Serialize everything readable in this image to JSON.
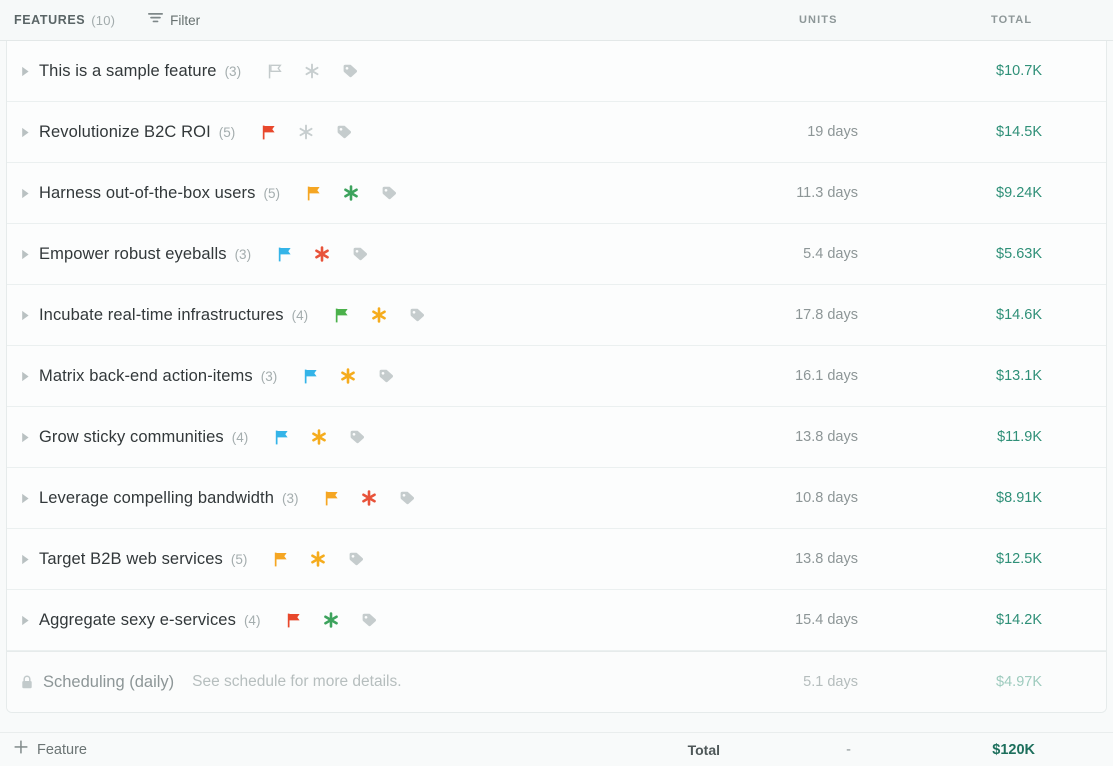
{
  "header": {
    "title": "FEATURES",
    "count": "(10)",
    "filter_label": "Filter",
    "filter_icon": "filter-icon",
    "units_label": "UNITS",
    "total_label": "TOTAL"
  },
  "colors": {
    "accent_total": "#2f9078",
    "footer_total": "#1d6f5c",
    "flag_red": "#e8482c",
    "flag_orange": "#f5a623",
    "flag_blue": "#34b4e8",
    "flag_green": "#4bb14b",
    "flag_grey": "#c3cacb",
    "star_red": "#e8533a",
    "star_orange": "#f5ac1d",
    "star_green": "#3da35d",
    "star_grey": "#c7cecf",
    "tag_grey": "#c5cccd"
  },
  "rows": [
    {
      "caret": "caret-right-icon",
      "name": "This is a sample feature",
      "subcount": "(3)",
      "flag": "none",
      "star": "none",
      "tag": "grey",
      "units": "",
      "total": "$10.7K"
    },
    {
      "caret": "caret-right-icon",
      "name": "Revolutionize B2C ROI",
      "subcount": "(5)",
      "flag": "red",
      "star": "none",
      "tag": "grey",
      "units": "19 days",
      "total": "$14.5K"
    },
    {
      "caret": "caret-right-icon",
      "name": "Harness out-of-the-box users",
      "subcount": "(5)",
      "flag": "orange",
      "star": "green",
      "tag": "grey",
      "units": "11.3 days",
      "total": "$9.24K"
    },
    {
      "caret": "caret-right-icon",
      "name": "Empower robust eyeballs",
      "subcount": "(3)",
      "flag": "blue",
      "star": "red",
      "tag": "grey",
      "units": "5.4 days",
      "total": "$5.63K"
    },
    {
      "caret": "caret-right-icon",
      "name": "Incubate real-time infrastructures",
      "subcount": "(4)",
      "flag": "green",
      "star": "orange",
      "tag": "grey",
      "units": "17.8 days",
      "total": "$14.6K"
    },
    {
      "caret": "caret-right-icon",
      "name": "Matrix back-end action-items",
      "subcount": "(3)",
      "flag": "blue",
      "star": "orange",
      "tag": "grey",
      "units": "16.1 days",
      "total": "$13.1K"
    },
    {
      "caret": "caret-right-icon",
      "name": "Grow sticky communities",
      "subcount": "(4)",
      "flag": "blue",
      "star": "orange",
      "tag": "grey",
      "units": "13.8 days",
      "total": "$11.9K"
    },
    {
      "caret": "caret-right-icon",
      "name": "Leverage compelling bandwidth",
      "subcount": "(3)",
      "flag": "orange",
      "star": "red",
      "tag": "grey",
      "units": "10.8 days",
      "total": "$8.91K"
    },
    {
      "caret": "caret-right-icon",
      "name": "Target B2B web services",
      "subcount": "(5)",
      "flag": "orange",
      "star": "orange",
      "tag": "grey",
      "units": "13.8 days",
      "total": "$12.5K"
    },
    {
      "caret": "caret-right-icon",
      "name": "Aggregate sexy e-services",
      "subcount": "(4)",
      "flag": "red",
      "star": "green",
      "tag": "grey",
      "units": "15.4 days",
      "total": "$14.2K"
    }
  ],
  "scheduling": {
    "lock_icon": "lock-icon",
    "name": "Scheduling (daily)",
    "note": "See schedule for more details.",
    "units": "5.1 days",
    "total": "$4.97K"
  },
  "footer": {
    "add_icon": "plus-icon",
    "add_label": "Feature",
    "total_label": "Total",
    "units": "-",
    "total": "$120K"
  }
}
